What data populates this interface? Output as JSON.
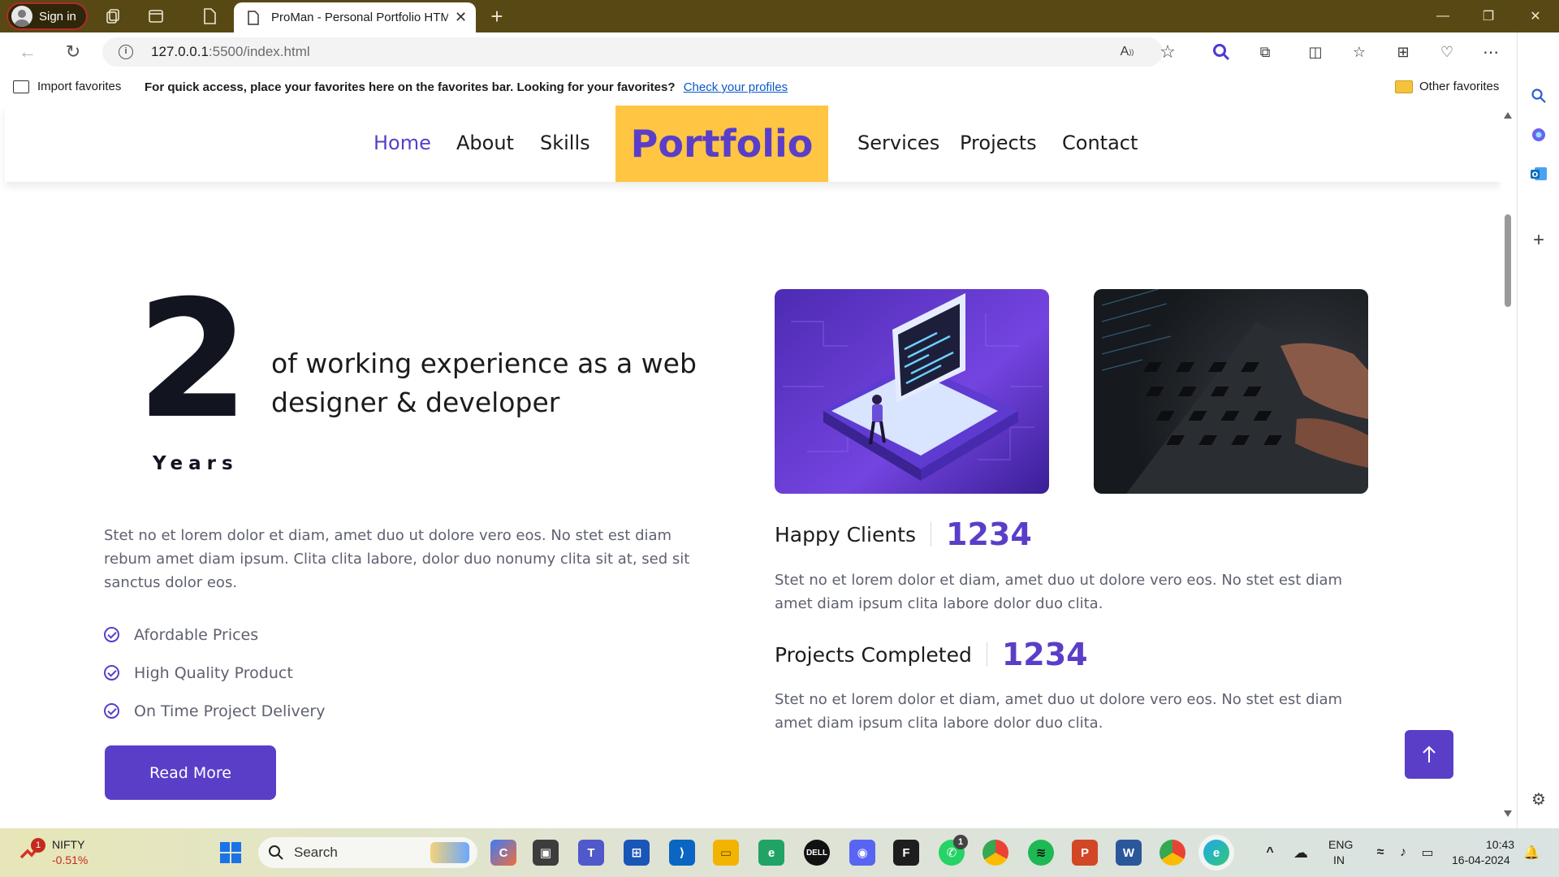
{
  "browser": {
    "signin_label": "Sign in",
    "tab_title": "ProMan - Personal Portfolio HTML Template",
    "url_host": "127.0.0.1",
    "url_path": ":5500/index.html",
    "favorites_bar": {
      "import_label": "Import favorites",
      "message": "For quick access, place your favorites here on the favorites bar. Looking for your favorites?",
      "link_label": "Check your profiles",
      "other_label": "Other favorites"
    }
  },
  "site": {
    "nav": {
      "brand": "Portfolio",
      "left_links": [
        "Home",
        "About",
        "Skills"
      ],
      "right_links": [
        "Services",
        "Projects",
        "Contact"
      ],
      "active": "Home"
    },
    "about": {
      "years_number": "2",
      "years_label": "Years",
      "experience_text": "of working experience as a web designer & developer",
      "description": "Stet no et lorem dolor et diam, amet duo ut dolore vero eos. No stet est diam rebum amet diam ipsum. Clita clita labore, dolor duo nonumy clita sit at, sed sit sanctus dolor eos.",
      "features": [
        "Afordable Prices",
        "High Quality Product",
        "On Time Project Delivery"
      ],
      "button_label": "Read More"
    },
    "stats": [
      {
        "label": "Happy Clients",
        "value": "1234",
        "text": "Stet no et lorem dolor et diam, amet duo ut dolore vero eos. No stet est diam amet diam ipsum clita labore dolor duo clita."
      },
      {
        "label": "Projects Completed",
        "value": "1234",
        "text": "Stet no et lorem dolor et diam, amet duo ut dolore vero eos. No stet est diam amet diam ipsum clita labore dolor duo clita."
      }
    ],
    "back_to_top_icon": "arrow-up-icon",
    "accent_color": "#5a3ec8",
    "brand_bg_color": "#ffc543"
  },
  "taskbar": {
    "stock_name": "NIFTY",
    "stock_change": "-0.51%",
    "stock_badge": "1",
    "search_label": "Search",
    "whatsapp_badge": "1",
    "lang_top": "ENG",
    "lang_bottom": "IN",
    "time": "10:43",
    "date": "16-04-2024"
  }
}
